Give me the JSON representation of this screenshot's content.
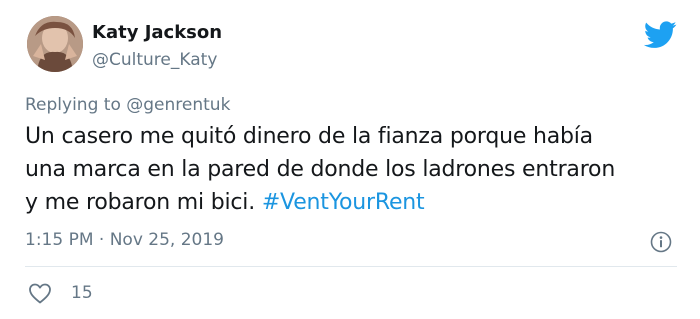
{
  "user": {
    "name": "Katy Jackson",
    "handle": "@Culture_Katy"
  },
  "reply": {
    "prefix": "Replying to ",
    "mention": "@genrentuk"
  },
  "body": {
    "line1": "Un casero me quitó dinero de la fianza porque había",
    "line2": "una marca en la pared de donde los ladrones entraron",
    "line3_text": "y me robaron mi bici. ",
    "hashtag": "#VentYourRent"
  },
  "meta": {
    "timestamp": "1:15 PM · Nov 25, 2019"
  },
  "actions": {
    "like_count": "15"
  },
  "icons": {
    "brand": "twitter-bird-icon",
    "info": "info-icon",
    "like": "heart-icon"
  },
  "colors": {
    "brand_blue": "#1da1f2",
    "link_blue": "#1b95e0",
    "muted": "#657786",
    "text": "#14171a"
  }
}
